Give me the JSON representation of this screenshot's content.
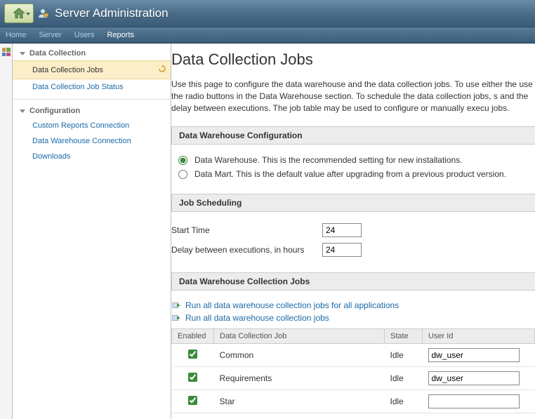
{
  "header": {
    "title": "Server Administration"
  },
  "nav": {
    "home": "Home",
    "server": "Server",
    "users": "Users",
    "reports": "Reports"
  },
  "sidebar": {
    "sections": [
      {
        "title": "Data Collection",
        "items": [
          {
            "label": "Data Collection Jobs",
            "active": true
          },
          {
            "label": "Data Collection Job Status",
            "active": false
          }
        ]
      },
      {
        "title": "Configuration",
        "items": [
          {
            "label": "Custom Reports Connection"
          },
          {
            "label": "Data Warehouse Connection"
          },
          {
            "label": "Downloads"
          }
        ]
      }
    ]
  },
  "main": {
    "heading": "Data Collection Jobs",
    "intro": "Use this page to configure the data warehouse and the data collection jobs. To use either the use the radio buttons in the Data Warehouse section. To schedule the data collection jobs, s and the delay between executions. The job table may be used to configure or manually execu jobs.",
    "dw_config": {
      "bar": "Data Warehouse Configuration",
      "opt1": "Data Warehouse. This is the recommended setting for new installations.",
      "opt2": "Data Mart. This is the default value after upgrading from a previous product version."
    },
    "schedule": {
      "bar": "Job Scheduling",
      "start_label": "Start Time",
      "start_value": "24",
      "delay_label": "Delay between executions, in hours",
      "delay_value": "24"
    },
    "jobs_section": {
      "bar": "Data Warehouse Collection Jobs",
      "link_all_apps": "Run all data warehouse collection jobs for all applications",
      "link_all": "Run all data warehouse collection jobs",
      "cols": {
        "enabled": "Enabled",
        "job": "Data Collection Job",
        "state": "State",
        "user": "User Id"
      },
      "rows": [
        {
          "enabled": true,
          "job": "Common",
          "state": "Idle",
          "user": "dw_user"
        },
        {
          "enabled": true,
          "job": "Requirements",
          "state": "Idle",
          "user": "dw_user"
        },
        {
          "enabled": true,
          "job": "Star",
          "state": "Idle",
          "user": ""
        }
      ]
    }
  }
}
